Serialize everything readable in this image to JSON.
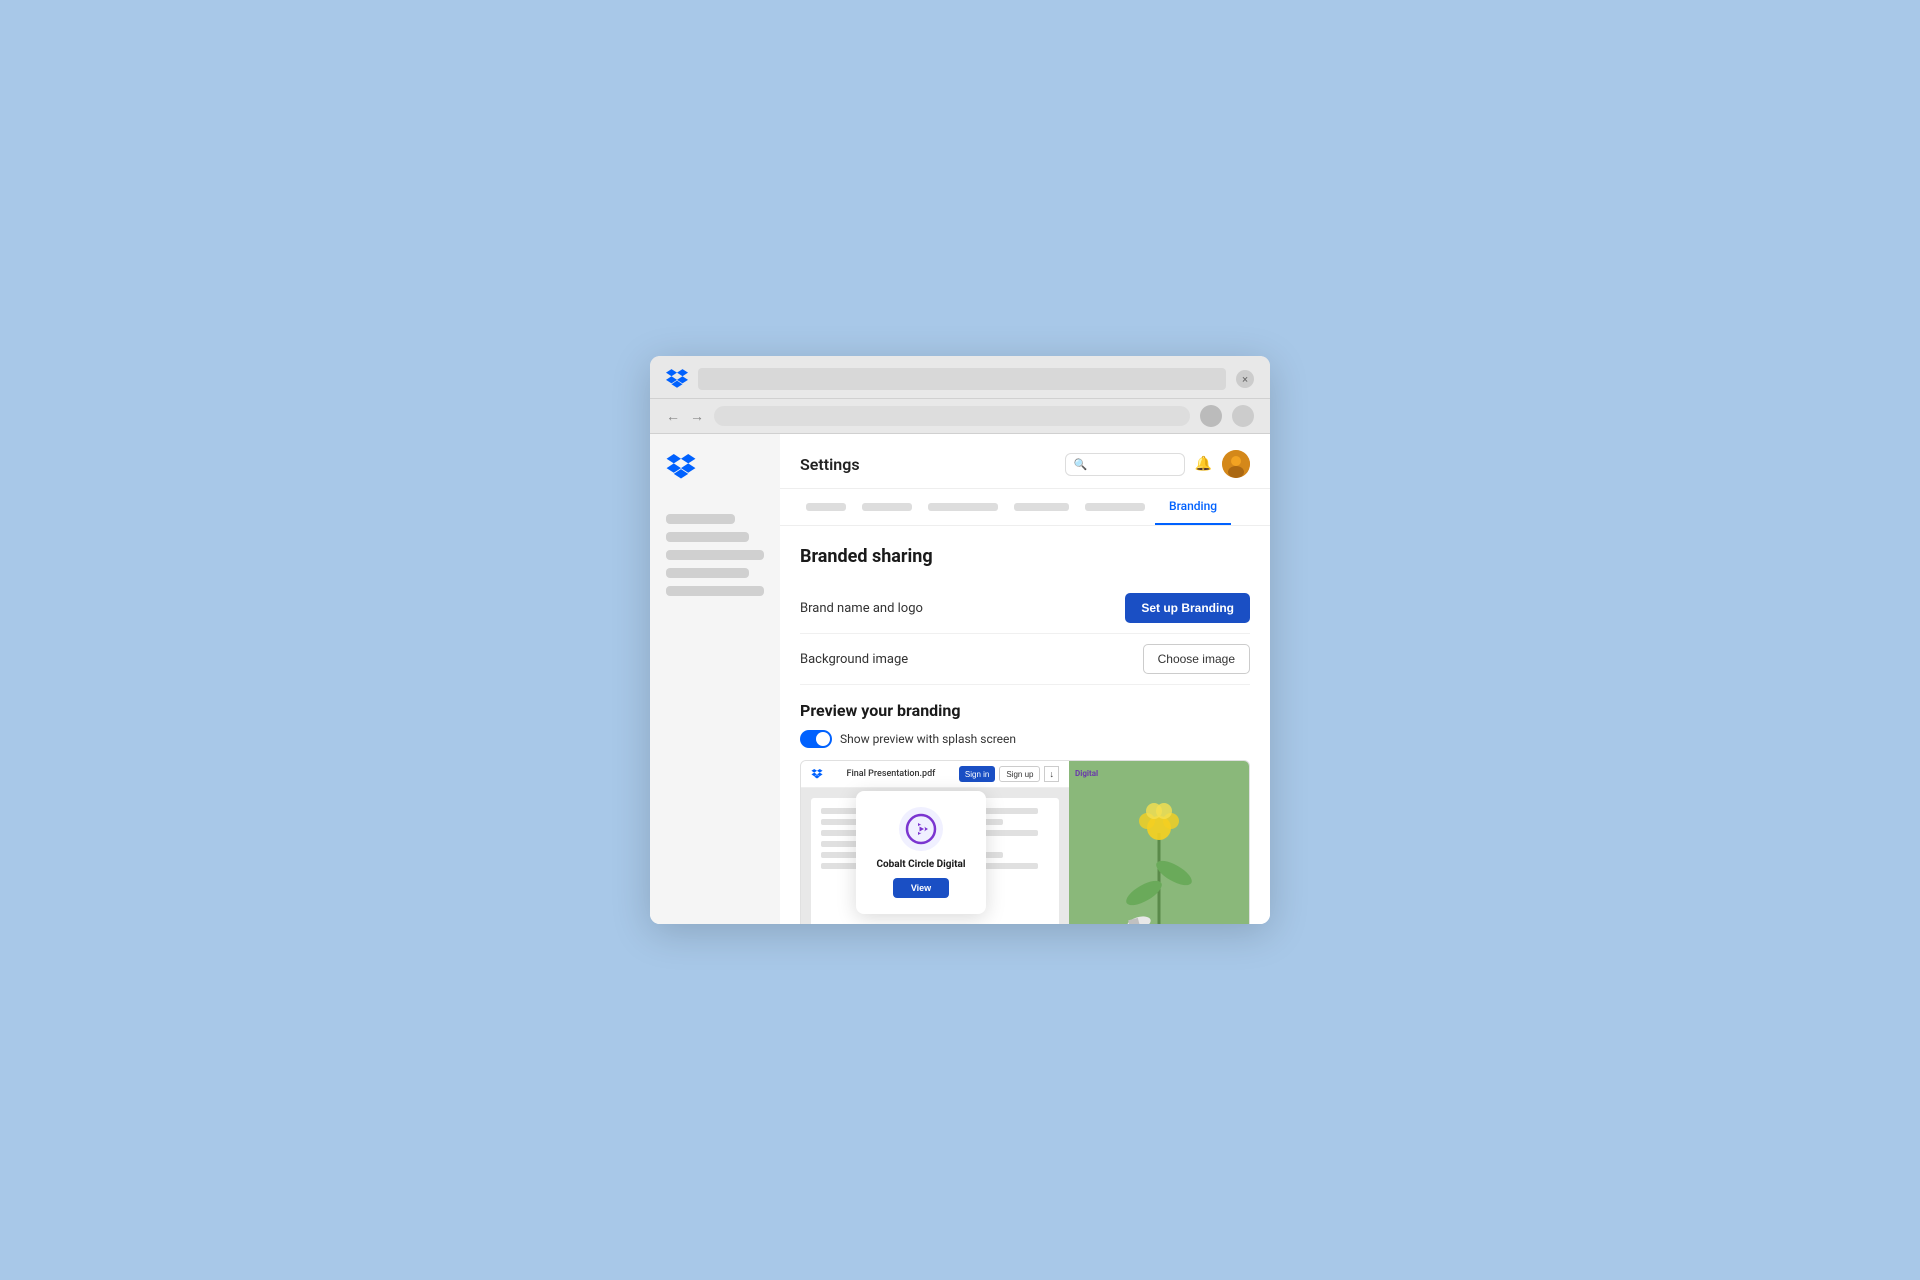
{
  "browser": {
    "url_placeholder": "",
    "close_label": "×"
  },
  "header": {
    "title": "Settings",
    "search_placeholder": ""
  },
  "tabs": {
    "placeholders": [
      "",
      "",
      "",
      "",
      ""
    ],
    "active_tab": "Branding"
  },
  "settings": {
    "section_title": "Branded sharing",
    "brand_name_label": "Brand name and logo",
    "setup_branding_btn": "Set up Branding",
    "background_image_label": "Background image",
    "choose_image_btn": "Choose image",
    "preview_section_title": "Preview your branding",
    "preview_toggle_label": "Show preview with splash screen",
    "preview_filename": "Final Presentation.pdf",
    "preview_signin_btn": "Sign in",
    "preview_signup_btn": "Sign up",
    "preview_brand_name": "Cobalt Circle Digital",
    "preview_view_btn": "View"
  }
}
